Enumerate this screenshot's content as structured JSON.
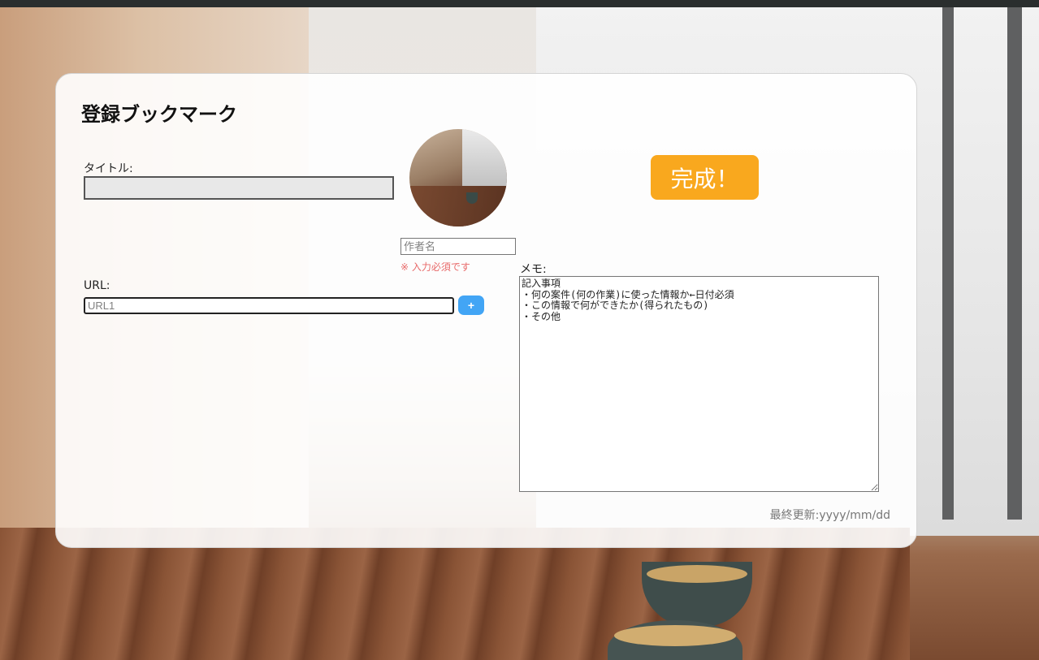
{
  "form": {
    "heading": "登録ブックマーク",
    "title_label": "タイトル:",
    "title_value": "",
    "author_placeholder": "作者名",
    "required_note": "※ 入力必須です",
    "done_label": "完成！",
    "url_label": "URL:",
    "url_placeholder": "URL1",
    "add_label": "+",
    "memo_label": "メモ:",
    "memo_value": "記入事項\n・何の案件(何の作業)に使った情報か←日付必須\n・この情報で何ができたか(得られたもの)\n・その他",
    "updated_text": "最終更新:yyyy/mm/dd"
  },
  "colors": {
    "done_button": "#f9a81e",
    "add_button": "#42a5f5",
    "required_text": "#e86a6a"
  }
}
